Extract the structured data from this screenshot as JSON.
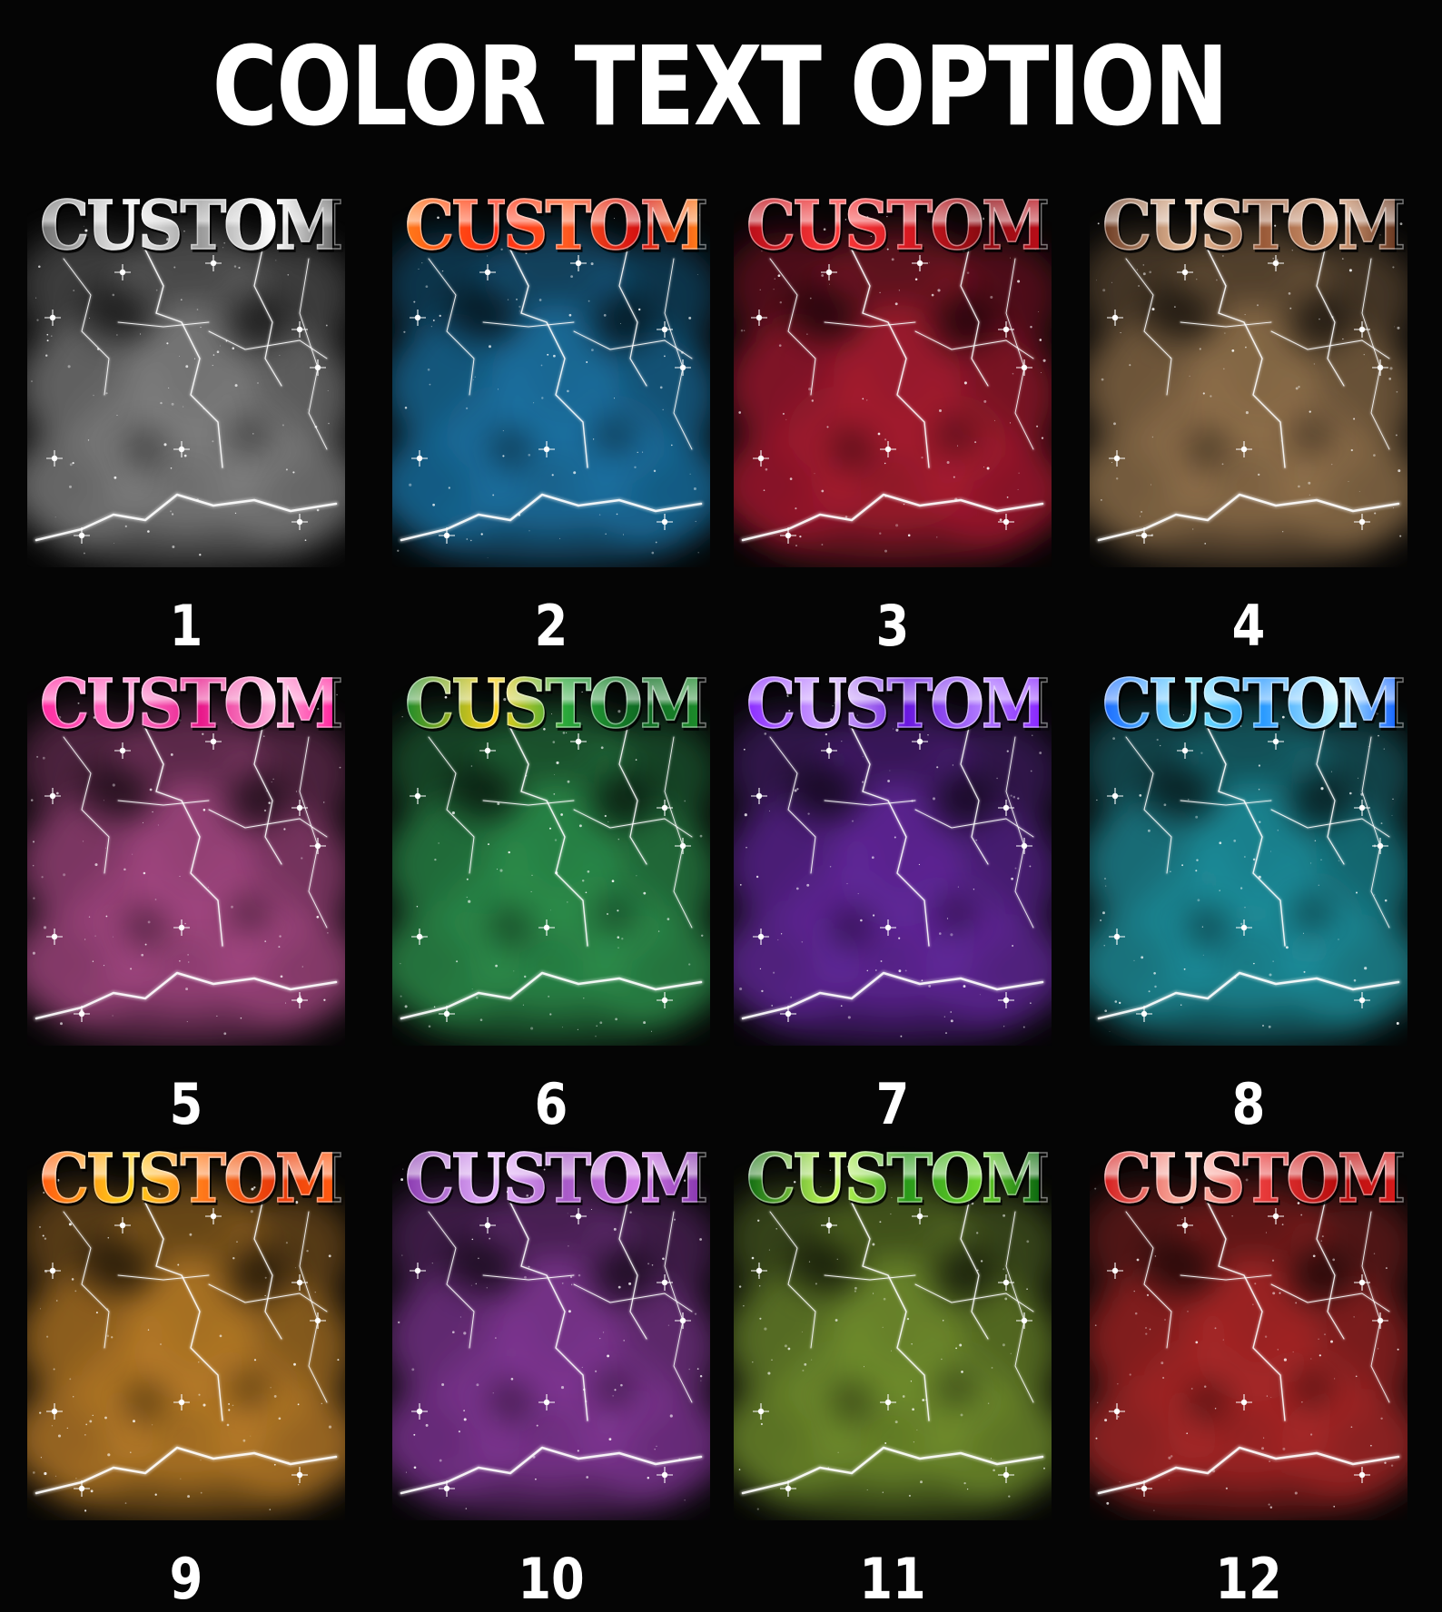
{
  "title": "COLOR TEXT OPTION",
  "options": [
    {
      "word": "CUSTOM",
      "number": "1",
      "text_colors": [
        "#6e6e6e",
        "#f2f2f2",
        "#9a9a9a",
        "#ffffff"
      ],
      "cloud_color": "#8a8a8a"
    },
    {
      "word": "CUSTOM",
      "number": "2",
      "text_colors": [
        "#ff7a1a",
        "#ff2a10",
        "#ff5a20",
        "#d41010"
      ],
      "cloud_color": "#1d7bb0"
    },
    {
      "word": "CUSTOM",
      "number": "3",
      "text_colors": [
        "#b80d18",
        "#ff3a3a",
        "#d81a22",
        "#8a0a10"
      ],
      "cloud_color": "#b51c34"
    },
    {
      "word": "CUSTOM",
      "number": "4",
      "text_colors": [
        "#6b3a22",
        "#f1c6a2",
        "#9a5a38",
        "#d9a07a"
      ],
      "cloud_color": "#9c7a52"
    },
    {
      "word": "CUSTOM",
      "number": "5",
      "text_colors": [
        "#ff2aa0",
        "#ff7ac8",
        "#e8188a",
        "#ffb0dc"
      ],
      "cloud_color": "#b04c8c"
    },
    {
      "word": "CUSTOM",
      "number": "6",
      "text_colors": [
        "#1c8a2a",
        "#ffd21a",
        "#2aa83a",
        "#0e6a22"
      ],
      "cloud_color": "#2f9a52"
    },
    {
      "word": "CUSTOM",
      "number": "7",
      "text_colors": [
        "#8a2aff",
        "#d6b2ff",
        "#6a18e0",
        "#b07aff"
      ],
      "cloud_color": "#6a2aa8"
    },
    {
      "word": "CUSTOM",
      "number": "8",
      "text_colors": [
        "#1a6aff",
        "#7ae8ff",
        "#2a9aff",
        "#bff6ff"
      ],
      "cloud_color": "#1f9aa8"
    },
    {
      "word": "CUSTOM",
      "number": "9",
      "text_colors": [
        "#ff5a10",
        "#ffd21a",
        "#ff7a1a",
        "#e83a0a"
      ],
      "cloud_color": "#c8862a"
    },
    {
      "word": "CUSTOM",
      "number": "10",
      "text_colors": [
        "#8a3ab0",
        "#e6b2ff",
        "#a85ac8",
        "#d27ae8"
      ],
      "cloud_color": "#8a3aa0"
    },
    {
      "word": "CUSTOM",
      "number": "11",
      "text_colors": [
        "#0e6a10",
        "#c8ff5a",
        "#2a9a1a",
        "#6ad22a"
      ],
      "cloud_color": "#7a9a30"
    },
    {
      "word": "CUSTOM",
      "number": "12",
      "text_colors": [
        "#d41a1a",
        "#ffc0b0",
        "#e83a3a",
        "#b80d0d"
      ],
      "cloud_color": "#b82a2a"
    }
  ]
}
